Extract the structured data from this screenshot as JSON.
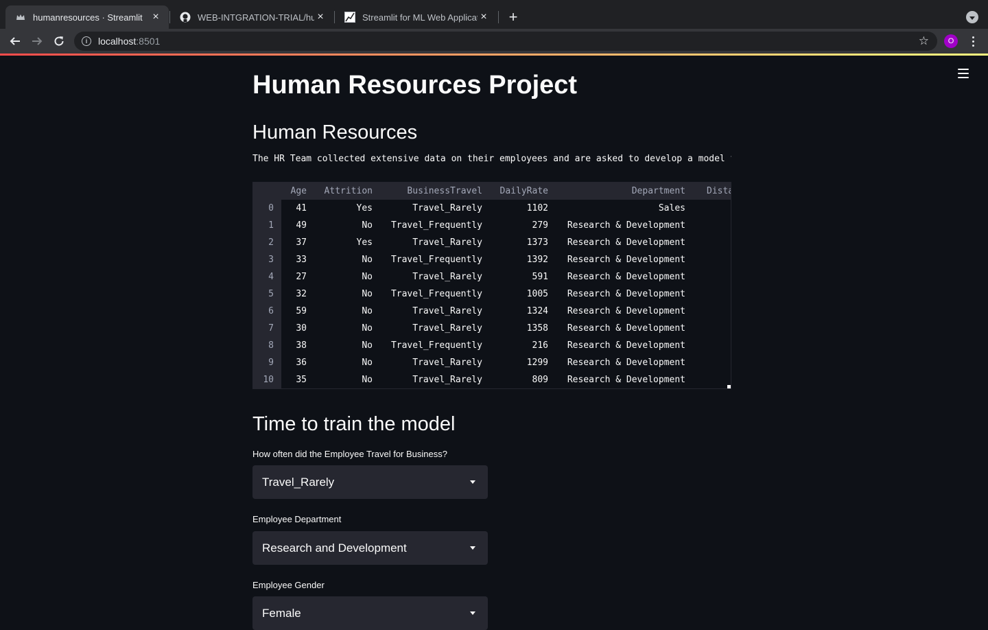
{
  "browser": {
    "tabs": [
      {
        "title": "humanresources · Streamlit",
        "favicon": "streamlit-crown-icon",
        "active": true
      },
      {
        "title": "WEB-INTGRATION-TRIAL/hum",
        "favicon": "github-icon",
        "active": false
      },
      {
        "title": "Streamlit for ML Web Applicatio",
        "favicon": "chart-icon",
        "active": false
      }
    ],
    "url_host": "localhost",
    "url_port": ":8501",
    "profile_initial": "O"
  },
  "app": {
    "title": "Human Resources Project",
    "section_heading": "Human Resources",
    "description": "The HR Team collected extensive data on their employees and are asked to develop a model th",
    "table": {
      "columns": [
        "Age",
        "Attrition",
        "BusinessTravel",
        "DailyRate",
        "Department",
        "Dista"
      ],
      "rows": [
        {
          "index": "0",
          "cells": [
            "41",
            "Yes",
            "Travel_Rarely",
            "1102",
            "Sales"
          ]
        },
        {
          "index": "1",
          "cells": [
            "49",
            "No",
            "Travel_Frequently",
            "279",
            "Research & Development"
          ]
        },
        {
          "index": "2",
          "cells": [
            "37",
            "Yes",
            "Travel_Rarely",
            "1373",
            "Research & Development"
          ]
        },
        {
          "index": "3",
          "cells": [
            "33",
            "No",
            "Travel_Frequently",
            "1392",
            "Research & Development"
          ]
        },
        {
          "index": "4",
          "cells": [
            "27",
            "No",
            "Travel_Rarely",
            "591",
            "Research & Development"
          ]
        },
        {
          "index": "5",
          "cells": [
            "32",
            "No",
            "Travel_Frequently",
            "1005",
            "Research & Development"
          ]
        },
        {
          "index": "6",
          "cells": [
            "59",
            "No",
            "Travel_Rarely",
            "1324",
            "Research & Development"
          ]
        },
        {
          "index": "7",
          "cells": [
            "30",
            "No",
            "Travel_Rarely",
            "1358",
            "Research & Development"
          ]
        },
        {
          "index": "8",
          "cells": [
            "38",
            "No",
            "Travel_Frequently",
            "216",
            "Research & Development"
          ]
        },
        {
          "index": "9",
          "cells": [
            "36",
            "No",
            "Travel_Rarely",
            "1299",
            "Research & Development"
          ]
        },
        {
          "index": "10",
          "cells": [
            "35",
            "No",
            "Travel_Rarely",
            "809",
            "Research & Development"
          ]
        }
      ]
    },
    "train_heading": "Time to train the model",
    "inputs": [
      {
        "label": "How often did the Employee Travel for Business?",
        "value": "Travel_Rarely"
      },
      {
        "label": "Employee Department",
        "value": "Research and Development"
      },
      {
        "label": "Employee Gender",
        "value": "Female"
      }
    ]
  }
}
